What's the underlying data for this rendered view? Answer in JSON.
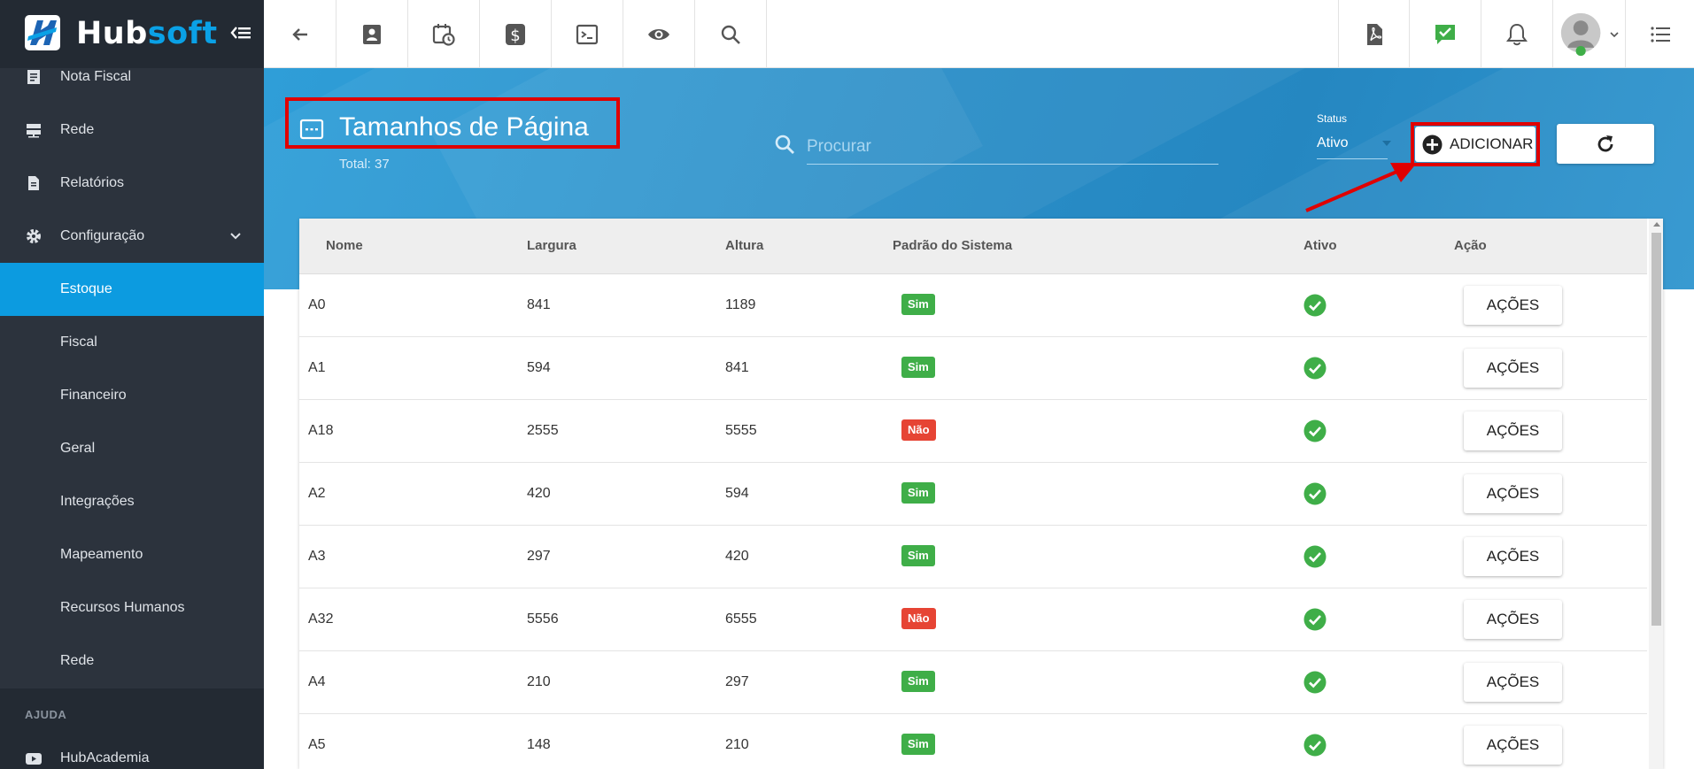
{
  "app": {
    "logo_text_a": "Hub",
    "logo_text_b": "soft"
  },
  "sidebar": {
    "items": [
      {
        "label": "Nota Fiscal",
        "icon": "receipt-icon"
      },
      {
        "label": "Rede",
        "icon": "server-icon"
      },
      {
        "label": "Relatórios",
        "icon": "document-icon"
      },
      {
        "label": "Configuração",
        "icon": "gear-icon"
      },
      {
        "label": "Estoque"
      },
      {
        "label": "Fiscal"
      },
      {
        "label": "Financeiro"
      },
      {
        "label": "Geral"
      },
      {
        "label": "Integrações"
      },
      {
        "label": "Mapeamento"
      },
      {
        "label": "Recursos Humanos"
      },
      {
        "label": "Rede"
      }
    ],
    "section_help": "AJUDA",
    "help_item": {
      "label": "HubAcademia",
      "icon": "youtube-icon"
    }
  },
  "header": {
    "title": "Tamanhos de Página",
    "total": "Total: 37",
    "search_placeholder": "Procurar",
    "status_label": "Status",
    "status_value": "Ativo",
    "add_label": "ADICIONAR"
  },
  "table": {
    "columns": [
      "Nome",
      "Largura",
      "Altura",
      "Padrão do Sistema",
      "Ativo",
      "Ação"
    ],
    "action_label": "AÇÕES",
    "rows": [
      {
        "nome": "A0",
        "largura": "841",
        "altura": "1189",
        "padrao": "Sim"
      },
      {
        "nome": "A1",
        "largura": "594",
        "altura": "841",
        "padrao": "Sim"
      },
      {
        "nome": "A18",
        "largura": "2555",
        "altura": "5555",
        "padrao": "Não"
      },
      {
        "nome": "A2",
        "largura": "420",
        "altura": "594",
        "padrao": "Sim"
      },
      {
        "nome": "A3",
        "largura": "297",
        "altura": "420",
        "padrao": "Sim"
      },
      {
        "nome": "A32",
        "largura": "5556",
        "altura": "6555",
        "padrao": "Não"
      },
      {
        "nome": "A4",
        "largura": "210",
        "altura": "297",
        "padrao": "Sim"
      },
      {
        "nome": "A5",
        "largura": "148",
        "altura": "210",
        "padrao": "Sim"
      }
    ]
  },
  "colors": {
    "sidebar_bg": "#2c333d",
    "accent": "#0c9be0",
    "header_band": "#2a8fc9",
    "highlight_red": "#e00000",
    "badge_yes": "#3fae48",
    "badge_no": "#e64434"
  }
}
